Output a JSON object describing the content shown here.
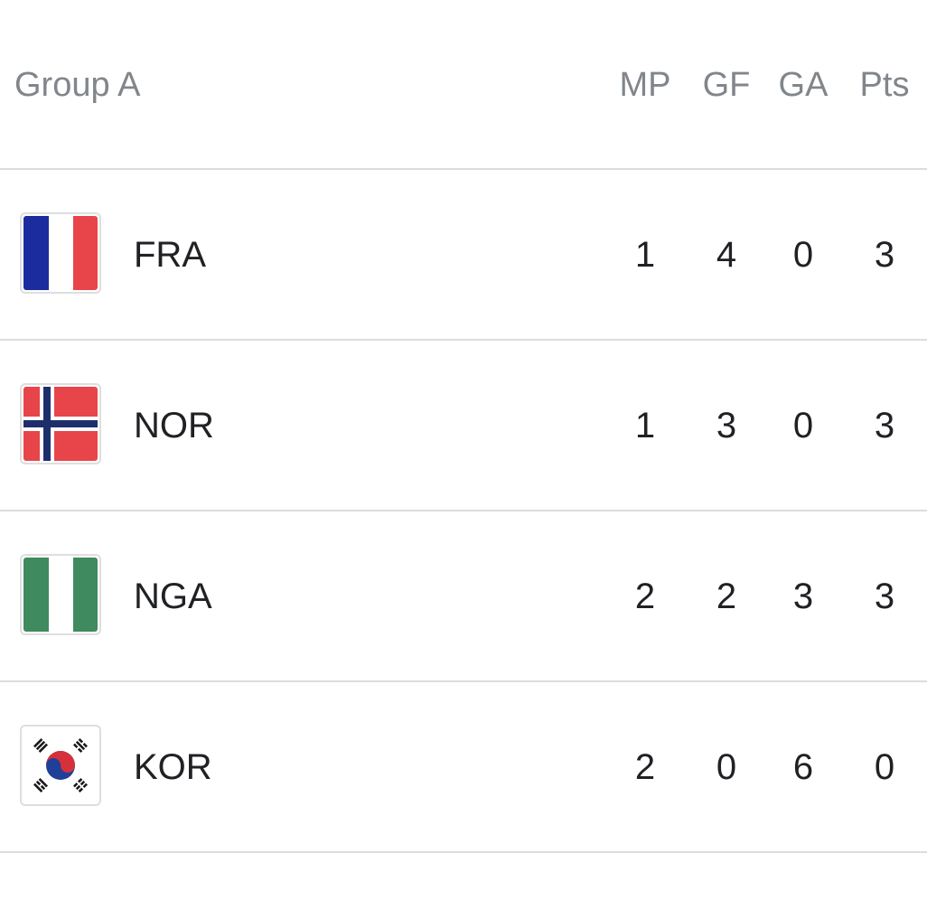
{
  "group": {
    "title": "Group A"
  },
  "columns": {
    "mp": "MP",
    "gf": "GF",
    "ga": "GA",
    "pts": "Pts"
  },
  "teams": [
    {
      "code": "FRA",
      "flag": "france-flag-icon",
      "mp": "1",
      "gf": "4",
      "ga": "0",
      "pts": "3"
    },
    {
      "code": "NOR",
      "flag": "norway-flag-icon",
      "mp": "1",
      "gf": "3",
      "ga": "0",
      "pts": "3"
    },
    {
      "code": "NGA",
      "flag": "nigeria-flag-icon",
      "mp": "2",
      "gf": "2",
      "ga": "3",
      "pts": "3"
    },
    {
      "code": "KOR",
      "flag": "south-korea-flag-icon",
      "mp": "2",
      "gf": "0",
      "ga": "6",
      "pts": "0"
    }
  ],
  "colors": {
    "header_text": "#80868b",
    "body_text": "#202124",
    "divider": "#dadce0"
  }
}
